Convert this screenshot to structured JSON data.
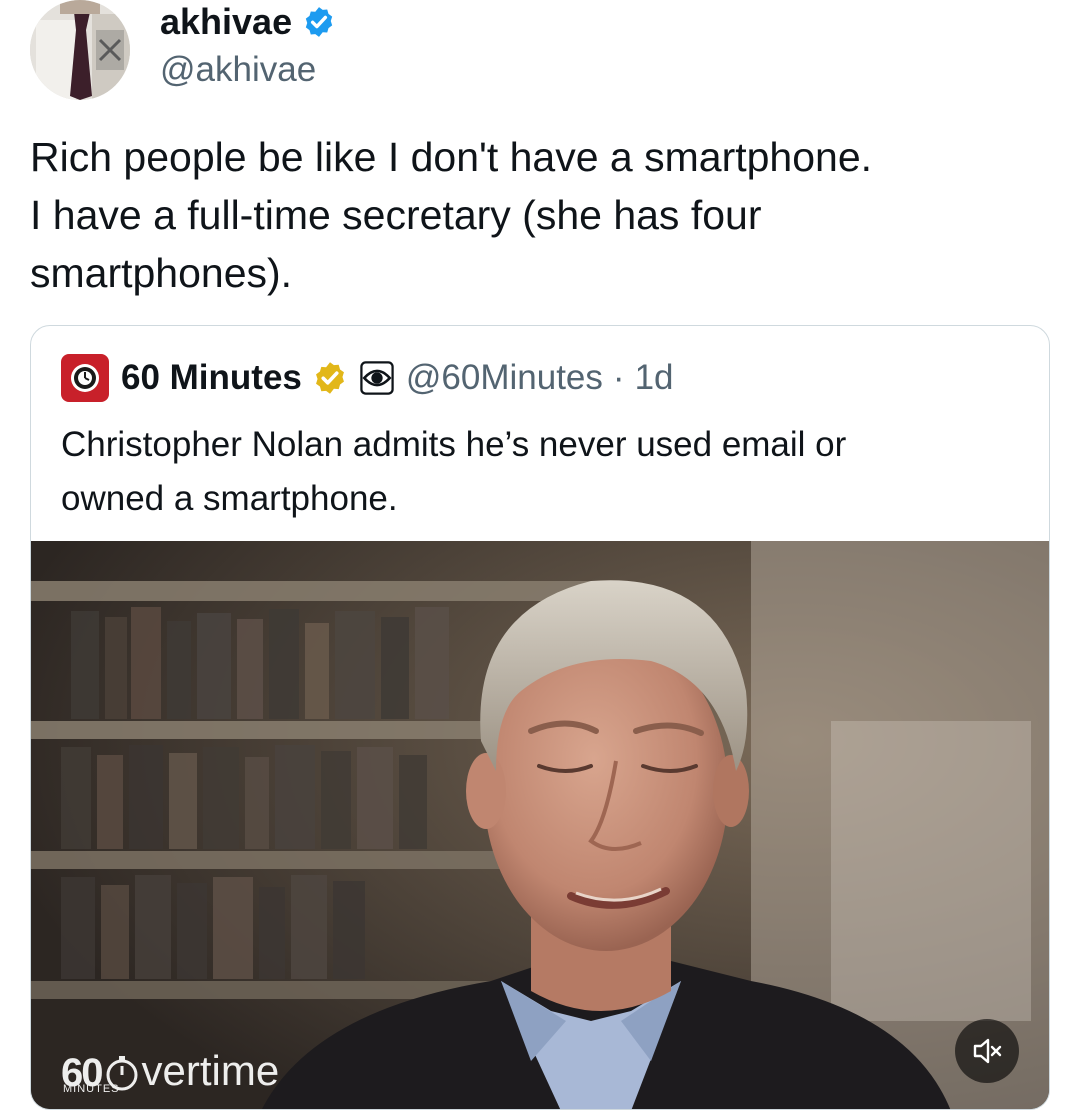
{
  "author": {
    "name": "akhivae",
    "handle": "@akhivae"
  },
  "tweet": {
    "lines": [
      "Rich people be like I don't have a smartphone.",
      "I have a full-time secretary (she has four",
      "smartphones)."
    ]
  },
  "quoted": {
    "name": "60 Minutes",
    "handle": "@60Minutes",
    "separator": "·",
    "time": "1d",
    "lines": [
      "Christopher Nolan admits he’s never used email or",
      "owned a smartphone."
    ]
  },
  "video": {
    "watermark_number": "60",
    "watermark_sub": "MINUTES",
    "watermark_word": "vertime",
    "mute_icon": "speaker-muted-icon"
  },
  "colors": {
    "verified_blue": "#1d9bf0",
    "verified_gold": "#e2b719",
    "logo_red": "#c8202a",
    "muted_text": "#536471"
  }
}
